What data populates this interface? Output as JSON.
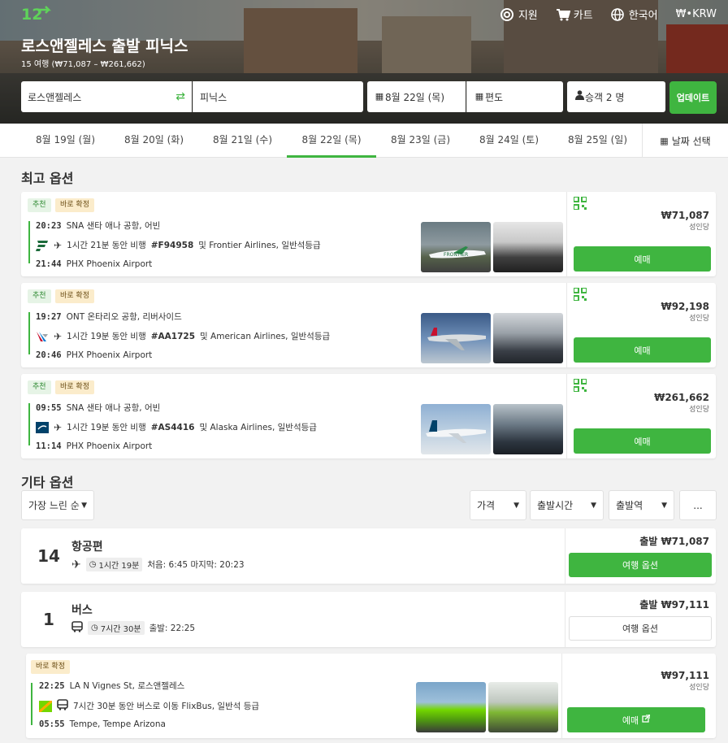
{
  "header": {
    "logo_text": "12",
    "nav": [
      {
        "icon": "support-icon",
        "label": "지원"
      },
      {
        "icon": "cart-icon",
        "label": "카트"
      },
      {
        "icon": "globe-icon",
        "label": "한국어"
      },
      {
        "icon": "currency-icon",
        "label": "₩•KRW"
      }
    ],
    "title": "로스앤젤레스 출발 피닉스",
    "subtitle": "15 여행 (₩71,087 – ₩261,662)"
  },
  "search": {
    "from": "로스앤젤레스",
    "to": "피닉스",
    "date": "8월 22일 (목)",
    "trip_type": "편도",
    "passengers": "승객 2 명",
    "update_label": "업데이트"
  },
  "dates": {
    "tabs": [
      "8월 19일 (월)",
      "8월 20일 (화)",
      "8월 21일 (수)",
      "8월 22일 (목)",
      "8월 23일 (금)",
      "8월 24일 (토)",
      "8월 25일 (일)"
    ],
    "active_index": 3,
    "pick_label": "날짜 선택"
  },
  "best": {
    "heading": "최고 옵션",
    "items": [
      {
        "badge_rec": "추천",
        "badge_conf": "바로 확정",
        "dep_time": "20:23",
        "dep_place": "SNA 샌타 애나 공항, 어빈",
        "desc_pre": "1시간 21분 동안 비행",
        "flight_no": "#F94958",
        "desc_post": "및 Frontier Airlines, 일반석등급",
        "arr_time": "21:44",
        "arr_place": "PHX Phoenix Airport",
        "price": "₩71,087",
        "per": "성인당",
        "book": "예매",
        "brand": "#1c6b3b"
      },
      {
        "badge_rec": "추천",
        "badge_conf": "바로 확정",
        "dep_time": "19:27",
        "dep_place": "ONT 온타리오 공항, 리버사이드",
        "desc_pre": "1시간 19분 동안 비행",
        "flight_no": "#AA1725",
        "desc_post": "및 American Airlines, 일반석등급",
        "arr_time": "20:46",
        "arr_place": "PHX Phoenix Airport",
        "price": "₩92,198",
        "per": "성인당",
        "book": "예매",
        "brand": "#c8102e"
      },
      {
        "badge_rec": "추천",
        "badge_conf": "바로 확정",
        "dep_time": "09:55",
        "dep_place": "SNA 샌타 애나 공항, 어빈",
        "desc_pre": "1시간 19분 동안 비행",
        "flight_no": "#AS4416",
        "desc_post": "및 Alaska Airlines, 일반석등급",
        "arr_time": "11:14",
        "arr_place": "PHX Phoenix Airport",
        "price": "₩261,662",
        "per": "성인당",
        "book": "예매",
        "brand": "#01426a"
      }
    ]
  },
  "other": {
    "heading": "기타 옵션",
    "sort_label": "가장 느린 순",
    "filters": [
      "가격",
      "출발시간",
      "출발역",
      "..."
    ],
    "groups": [
      {
        "count": "14",
        "name": "항공편",
        "duration": "1시간 19분",
        "extra": "처음: 6:45 마지막: 20:23",
        "price_label": "출발 ₩71,087",
        "button": "여행 옵션"
      },
      {
        "count": "1",
        "name": "버스",
        "duration": "7시간 30분",
        "extra": "출발: 22:25",
        "price_label": "출발 ₩97,111",
        "button": "여행 옵션"
      }
    ],
    "bus_item": {
      "badge_conf": "바로 확정",
      "dep_time": "22:25",
      "dep_place": "LA N Vignes St, 로스앤젤레스",
      "desc": "7시간 30분 동안 버스로 이동 FlixBus, 일반석 등급",
      "arr_time": "05:55",
      "arr_place": "Tempe, Tempe Arizona",
      "price": "₩97,111",
      "per": "성인당",
      "book": "예매"
    }
  }
}
